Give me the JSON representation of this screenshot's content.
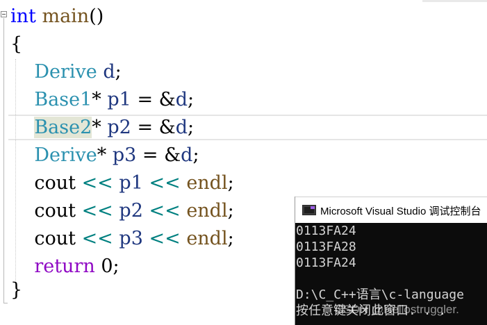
{
  "code": {
    "lines": [
      [
        {
          "t": "int",
          "c": "kw"
        },
        {
          "t": " "
        },
        {
          "t": "main",
          "c": "fn"
        },
        {
          "t": "()"
        }
      ],
      [
        {
          "t": "{"
        }
      ],
      [
        {
          "t": "    "
        },
        {
          "t": "Derive",
          "c": "type"
        },
        {
          "t": " "
        },
        {
          "t": "d",
          "c": "var"
        },
        {
          "t": ";"
        }
      ],
      [
        {
          "t": "    "
        },
        {
          "t": "Base1",
          "c": "type"
        },
        {
          "t": "* "
        },
        {
          "t": "p1",
          "c": "var"
        },
        {
          "t": " = &"
        },
        {
          "t": "d",
          "c": "var"
        },
        {
          "t": ";"
        }
      ],
      [
        {
          "t": "    "
        },
        {
          "t": "Base2",
          "c": "type hl-word"
        },
        {
          "t": "* "
        },
        {
          "t": "p2",
          "c": "var"
        },
        {
          "t": " = &"
        },
        {
          "t": "d",
          "c": "var"
        },
        {
          "t": ";"
        }
      ],
      [
        {
          "t": "    "
        },
        {
          "t": "Derive",
          "c": "type"
        },
        {
          "t": "* "
        },
        {
          "t": "p3",
          "c": "var"
        },
        {
          "t": " = &"
        },
        {
          "t": "d",
          "c": "var"
        },
        {
          "t": ";"
        }
      ],
      [
        {
          "t": "    "
        },
        {
          "t": "cout"
        },
        {
          "t": " "
        },
        {
          "t": "<<",
          "c": "op"
        },
        {
          "t": " "
        },
        {
          "t": "p1",
          "c": "var"
        },
        {
          "t": " "
        },
        {
          "t": "<<",
          "c": "op"
        },
        {
          "t": " "
        },
        {
          "t": "endl",
          "c": "fn"
        },
        {
          "t": ";"
        }
      ],
      [
        {
          "t": "    "
        },
        {
          "t": "cout"
        },
        {
          "t": " "
        },
        {
          "t": "<<",
          "c": "op"
        },
        {
          "t": " "
        },
        {
          "t": "p2",
          "c": "var"
        },
        {
          "t": " "
        },
        {
          "t": "<<",
          "c": "op"
        },
        {
          "t": " "
        },
        {
          "t": "endl",
          "c": "fn"
        },
        {
          "t": ";"
        }
      ],
      [
        {
          "t": "    "
        },
        {
          "t": "cout"
        },
        {
          "t": " "
        },
        {
          "t": "<<",
          "c": "op"
        },
        {
          "t": " "
        },
        {
          "t": "p3",
          "c": "var"
        },
        {
          "t": " "
        },
        {
          "t": "<<",
          "c": "op"
        },
        {
          "t": " "
        },
        {
          "t": "endl",
          "c": "fn"
        },
        {
          "t": ";"
        }
      ],
      [
        {
          "t": "    "
        },
        {
          "t": "return",
          "c": "kw2"
        },
        {
          "t": " 0;"
        }
      ],
      [
        {
          "t": "}"
        }
      ]
    ]
  },
  "console": {
    "title": "Microsoft Visual Studio 调试控制台",
    "output": [
      "0113FA24",
      "0113FA28",
      "0113FA24",
      "",
      "D:\\C_C++语言\\c-language",
      "按任意键关闭此窗口. . ."
    ],
    "watermark": "CSDN @Hellostruggler."
  },
  "icons": {
    "fold": "collapse-minus-icon",
    "console": "visual-studio-console-icon"
  },
  "colors": {
    "keyword": "#0000ff",
    "return_keyword": "#8f08c4",
    "type": "#2b91af",
    "function": "#74531f",
    "variable": "#1f377f",
    "operator": "#008080",
    "console_bg": "#0c0c0c",
    "console_text": "#d4d4d4"
  }
}
